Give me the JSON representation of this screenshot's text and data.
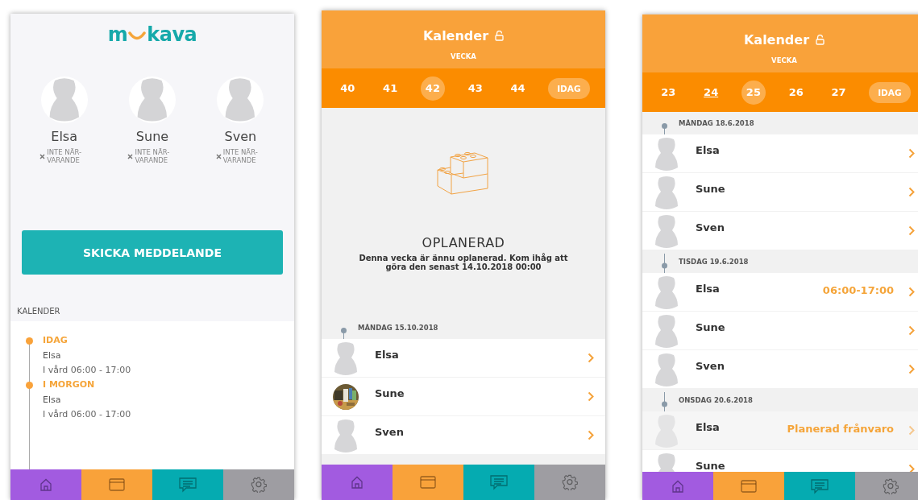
{
  "phones": [
    {
      "kind": "home",
      "logo": {
        "left": "m",
        "right": "kava"
      },
      "children": [
        {
          "name": "Elsa",
          "status": "INTE NÄR-VARANDE",
          "present": false
        },
        {
          "name": "Sune",
          "status": "INTE NÄR-VARANDE",
          "present": false
        },
        {
          "name": "Sven",
          "status": "INTE NÄR-VARANDE",
          "present": false
        }
      ],
      "send_button": "SKICKA MEDDELANDE",
      "calendar_heading": "KALENDER",
      "timeline": [
        {
          "day": "IDAG",
          "name": "Elsa",
          "detail": "I vård  06:00 - 17:00"
        },
        {
          "day": "I MORGON",
          "name": "Elsa",
          "detail": "I vård  06:00 - 17:00"
        }
      ],
      "nav": [
        {
          "color": "#a25be0"
        },
        {
          "color": "#f9a23a"
        },
        {
          "color": "#05abb1"
        },
        {
          "color": "#9e9da2"
        }
      ]
    },
    {
      "kind": "calendar",
      "title": "Kalender",
      "week_label": "VECKA",
      "weeks": [
        {
          "label": "40",
          "selected": false,
          "marked": false
        },
        {
          "label": "41",
          "selected": false,
          "marked": false
        },
        {
          "label": "42",
          "selected": true,
          "marked": false
        },
        {
          "label": "43",
          "selected": false,
          "marked": false
        },
        {
          "label": "44",
          "selected": false,
          "marked": false
        }
      ],
      "today_button": "IDAG",
      "empty_state": {
        "title": "OPLANERAD",
        "message": "Denna vecka är ännu oplanerad. Kom ihåg att göra den senast 14.10.2018 00:00"
      },
      "days": [
        {
          "date": "MÅNDAG 15.10.2018",
          "rows": [
            {
              "name": "Elsa",
              "photo": false,
              "faded": false
            },
            {
              "name": "Sune",
              "photo": true,
              "faded": false
            },
            {
              "name": "Sven",
              "photo": false,
              "faded": false
            }
          ]
        }
      ],
      "nav": [
        {
          "color": "#a25be0"
        },
        {
          "color": "#f9a23a"
        },
        {
          "color": "#05abb1"
        },
        {
          "color": "#9e9da2"
        }
      ]
    },
    {
      "kind": "calendar",
      "title": "Kalender",
      "week_label": "VECKA",
      "weeks": [
        {
          "label": "23",
          "selected": false,
          "marked": false
        },
        {
          "label": "24",
          "selected": false,
          "marked": true
        },
        {
          "label": "25",
          "selected": true,
          "marked": false
        },
        {
          "label": "26",
          "selected": false,
          "marked": false
        },
        {
          "label": "27",
          "selected": false,
          "marked": false
        }
      ],
      "today_button": "IDAG",
      "days": [
        {
          "date": "MÅNDAG 18.6.2018",
          "rows": [
            {
              "name": "Elsa",
              "photo": false,
              "faded": false
            },
            {
              "name": "Sune",
              "photo": false,
              "faded": false
            },
            {
              "name": "Sven",
              "photo": false,
              "faded": false
            }
          ]
        },
        {
          "date": "TISDAG 19.6.2018",
          "rows": [
            {
              "name": "Elsa",
              "photo": false,
              "faded": false,
              "status": "06:00-17:00"
            },
            {
              "name": "Sune",
              "photo": false,
              "faded": false
            },
            {
              "name": "Sven",
              "photo": false,
              "faded": false
            }
          ]
        },
        {
          "date": "ONSDAG 20.6.2018",
          "rows": [
            {
              "name": "Elsa",
              "photo": false,
              "faded": true,
              "status": "Planerad frånvaro"
            },
            {
              "name": "Sune",
              "photo": false,
              "faded": false
            }
          ]
        }
      ],
      "nav": [
        {
          "color": "#a25be0"
        },
        {
          "color": "#f9a23a"
        },
        {
          "color": "#05abb1"
        },
        {
          "color": "#9e9da2"
        }
      ]
    }
  ]
}
